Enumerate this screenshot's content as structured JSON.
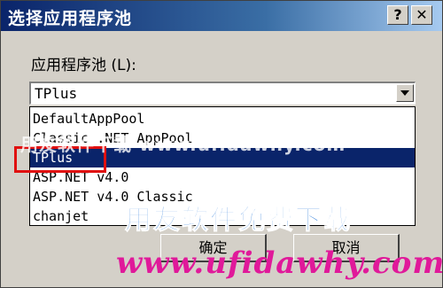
{
  "window": {
    "title": "选择应用程序池",
    "help_glyph": "?",
    "close_glyph": "✕"
  },
  "pool": {
    "label": "应用程序池 (L):",
    "selected": "TPlus",
    "options": [
      "DefaultAppPool",
      "Classic .NET AppPool",
      "TPlus",
      "ASP.NET v4.0",
      "ASP.NET v4.0 Classic",
      "chanjet"
    ],
    "selected_index": 2
  },
  "buttons": {
    "ok": "确定",
    "cancel": "取消"
  },
  "watermarks": {
    "line1": "用友软件下载 www.ufidawhy.com",
    "line2": "用友软件免费下载",
    "line3": "www.ufidawhy.com"
  },
  "colors": {
    "highlight_border": "#e01010",
    "selection_bg": "#0a246a",
    "title_bar": "#0a246a"
  }
}
